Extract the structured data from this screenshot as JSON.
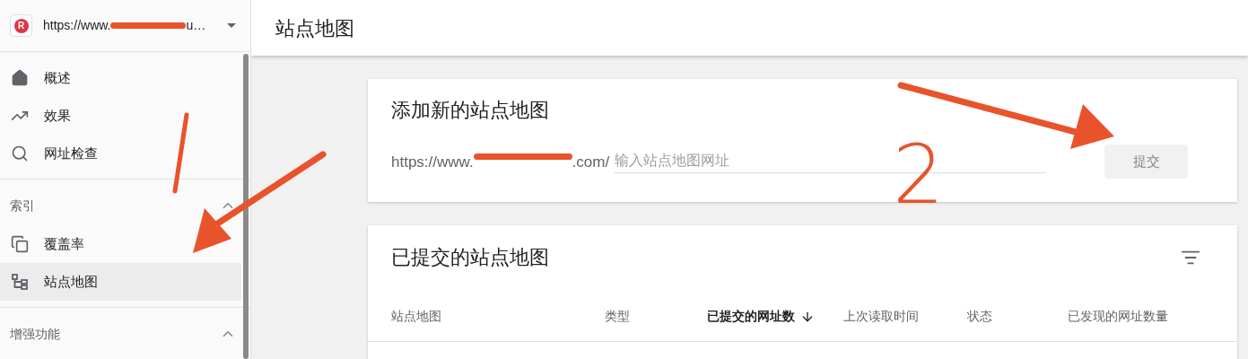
{
  "property": {
    "logo": "R",
    "url_prefix": "https://www.",
    "url_suffix": "u…"
  },
  "sidebar": {
    "items": [
      {
        "kind": "home",
        "label": "概述",
        "selected": false
      },
      {
        "kind": "trend",
        "label": "效果",
        "selected": false
      },
      {
        "kind": "search",
        "label": "网址检查",
        "selected": false
      },
      {
        "kind": "divider"
      },
      {
        "kind": "section",
        "label": "索引",
        "expanded": true
      },
      {
        "kind": "copy",
        "label": "覆盖率",
        "selected": false
      },
      {
        "kind": "tree",
        "label": "站点地图",
        "selected": true
      },
      {
        "kind": "divider"
      },
      {
        "kind": "section",
        "label": "增强功能",
        "expanded": true
      }
    ]
  },
  "page_title": "站点地图",
  "add_card": {
    "title": "添加新的站点地图",
    "url_prefix": "https://www.",
    "url_suffix": ".com/",
    "placeholder": "输入站点地图网址",
    "button": "提交"
  },
  "submitted_card": {
    "title": "已提交的站点地图",
    "columns": [
      {
        "label": "站点地图",
        "sorted": false
      },
      {
        "label": "类型",
        "sorted": false
      },
      {
        "label": "已提交的网址数",
        "sorted": true
      },
      {
        "label": "上次读取时间",
        "sorted": false
      },
      {
        "label": "状态",
        "sorted": false
      },
      {
        "label": "已发现的网址数量",
        "sorted": false
      }
    ]
  },
  "annotations": [
    {
      "kind": "arrow"
    },
    {
      "kind": "arrow"
    },
    {
      "kind": "stroke"
    },
    {
      "kind": "label",
      "text": "2"
    }
  ]
}
